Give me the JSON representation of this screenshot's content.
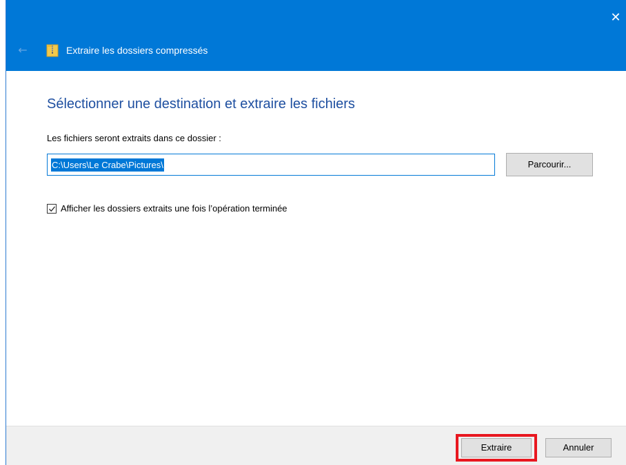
{
  "window": {
    "title": "Extraire les dossiers compressés",
    "close_glyph": "✕",
    "back_glyph": "←",
    "accent_color": "#0078d7",
    "icons": {
      "close": "close-icon",
      "back": "back-arrow-icon",
      "app": "zip-folder-icon"
    }
  },
  "main": {
    "heading": "Sélectionner une destination et extraire les fichiers",
    "destination_label": "Les fichiers seront extraits dans ce dossier :",
    "destination_value": "C:\\Users\\Le Crabe\\Pictures\\",
    "browse_label": "Parcourir...",
    "show_folders_checkbox": {
      "label": "Afficher les dossiers extraits une fois l’opération terminée",
      "checked": true
    }
  },
  "footer": {
    "extract_label": "Extraire",
    "cancel_label": "Annuler",
    "highlight_color": "#e8171f"
  }
}
